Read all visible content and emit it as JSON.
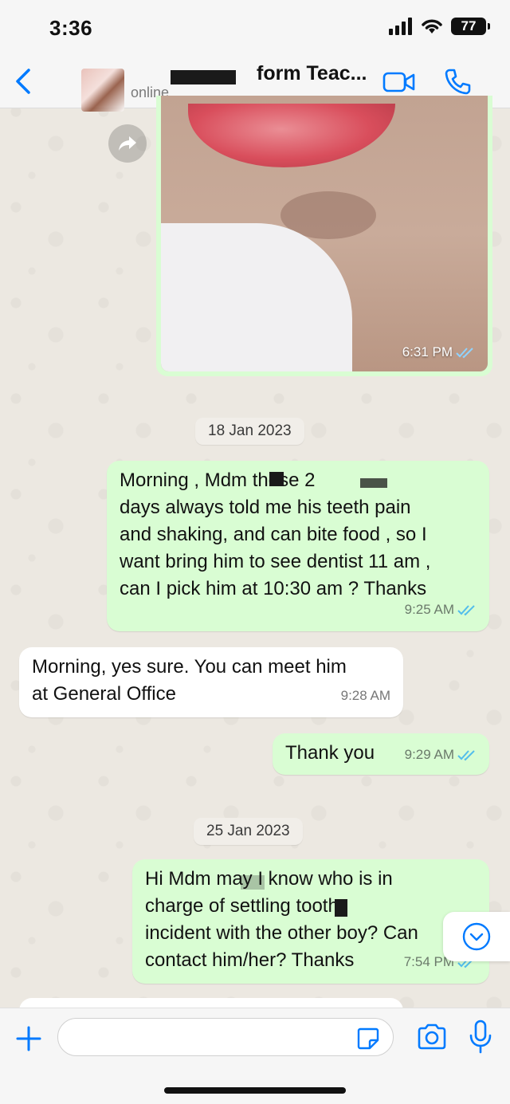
{
  "status_bar": {
    "time": "3:36",
    "battery": "77"
  },
  "header": {
    "contact_name": "form Teac...",
    "contact_status": "online"
  },
  "messages": [
    {
      "type": "image",
      "direction": "outgoing",
      "time": "6:31 PM",
      "read": true
    },
    {
      "type": "date",
      "text": "18 Jan 2023"
    },
    {
      "type": "text",
      "direction": "outgoing",
      "text": "Morning , Mdm              these 2\ndays always told me his teeth pain\nand shaking, and can bite food , so I\nwant bring him to see dentist 11 am ,\ncan I pick him at 10:30 am ? Thanks",
      "time": "9:25 AM",
      "read": true
    },
    {
      "type": "text",
      "direction": "incoming",
      "text": "Morning, yes sure. You can meet him\nat General Office",
      "time": "9:28 AM"
    },
    {
      "type": "text",
      "direction": "outgoing",
      "text": "Thank you",
      "time": "9:29 AM",
      "read": true
    },
    {
      "type": "date",
      "text": "25 Jan 2023"
    },
    {
      "type": "text",
      "direction": "outgoing",
      "text": "Hi Mdm          may I know who is in\ncharge of settling                tooth\nincident with the other boy? Can\ncontact him/her?  Thanks",
      "time": "7:54 PM",
      "read": true
    }
  ],
  "input": {
    "placeholder": ""
  },
  "colors": {
    "accent": "#007aff",
    "outgoing_bubble": "#d9fdd3",
    "incoming_bubble": "#ffffff",
    "read_ticks": "#53bdeb"
  },
  "icons": [
    "back-chevron-icon",
    "video-call-icon",
    "phone-icon",
    "forward-icon",
    "chevron-down-icon",
    "plus-icon",
    "sticker-icon",
    "camera-icon",
    "microphone-icon",
    "double-check-icon"
  ]
}
